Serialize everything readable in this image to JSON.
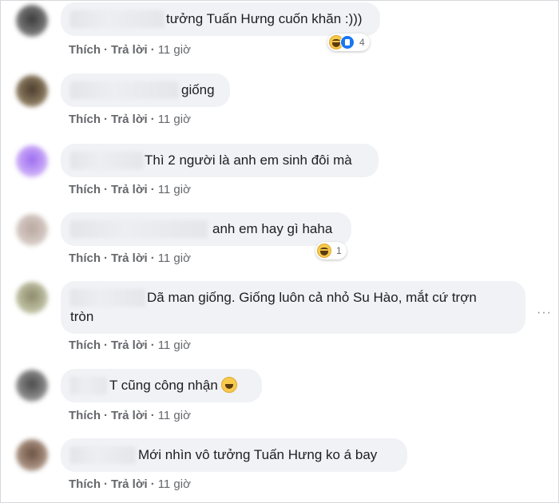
{
  "comments": [
    {
      "text": "tưởng Tuấn Hưng cuốn khăn :)))",
      "actions": {
        "like": "Thích",
        "reply": "Trả lời",
        "time": "11 giờ"
      },
      "reactions": {
        "count": "4",
        "types": [
          "haha",
          "like"
        ]
      }
    },
    {
      "text": "giống",
      "actions": {
        "like": "Thích",
        "reply": "Trả lời",
        "time": "11 giờ"
      }
    },
    {
      "text": "Thì 2 người là anh em sinh đôi mà",
      "actions": {
        "like": "Thích",
        "reply": "Trả lời",
        "time": "11 giờ"
      }
    },
    {
      "text": "anh em hay gì haha",
      "actions": {
        "like": "Thích",
        "reply": "Trả lời",
        "time": "11 giờ"
      },
      "reactions": {
        "count": "1",
        "types": [
          "haha"
        ]
      }
    },
    {
      "text_line1": "Dã man giống. Giống luôn cả nhỏ Su Hào, mắt cứ trợn",
      "text_line2": "tròn",
      "actions": {
        "like": "Thích",
        "reply": "Trả lời",
        "time": "11 giờ"
      }
    },
    {
      "text": "T cũng công nhận",
      "emoji": "rofl-emoji",
      "actions": {
        "like": "Thích",
        "reply": "Trả lời",
        "time": "11 giờ"
      }
    },
    {
      "text": "Mới nhìn vô tưởng Tuấn Hưng ko á bay",
      "actions": {
        "like": "Thích",
        "reply": "Trả lời",
        "time": "11 giờ"
      }
    }
  ],
  "more_options_icon": "more-horizontal-icon",
  "colors": {
    "bubble": "#f0f2f5",
    "action_text": "#65676b",
    "like_blue": "#1877f2",
    "haha_yellow": "#f7c94d"
  }
}
